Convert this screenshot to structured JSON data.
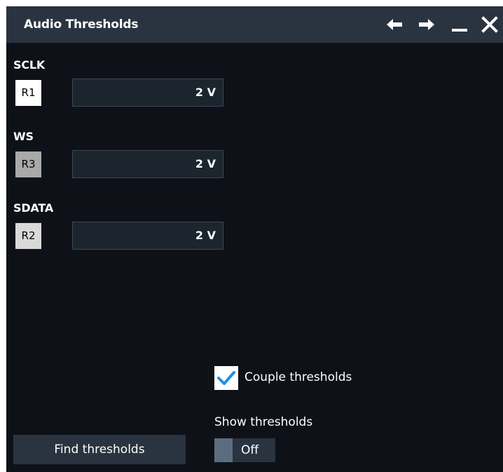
{
  "dialog": {
    "title": "Audio Thresholds",
    "icons": [
      "arrow-left-icon",
      "arrow-right-icon",
      "minimize-icon",
      "close-icon"
    ]
  },
  "channels": [
    {
      "label": "SCLK",
      "source": "R1",
      "value": "2 V",
      "source_color": "#ffffff"
    },
    {
      "label": "WS",
      "source": "R3",
      "value": "2 V",
      "source_color": "#a9a9a9"
    },
    {
      "label": "SDATA",
      "source": "R2",
      "value": "2 V",
      "source_color": "#d9d9d9"
    }
  ],
  "couple": {
    "label": "Couple thresholds",
    "checked": true,
    "check_color": "#1e90e8"
  },
  "show": {
    "label": "Show thresholds",
    "state": "Off"
  },
  "find_button": {
    "label": "Find thresholds"
  }
}
